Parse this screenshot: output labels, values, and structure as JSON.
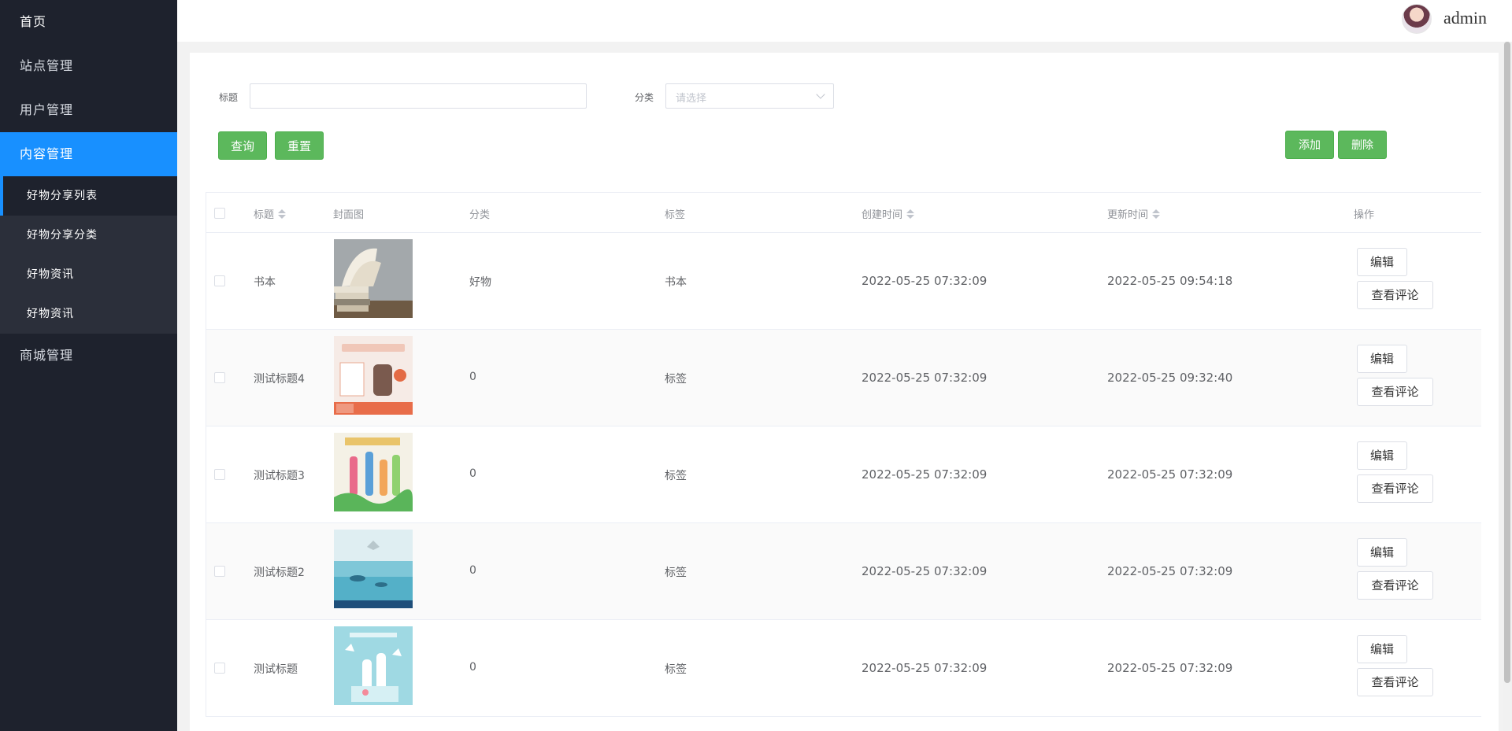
{
  "sidebar": {
    "home": "首页",
    "items": [
      {
        "label": "站点管理"
      },
      {
        "label": "用户管理"
      },
      {
        "label": "内容管理"
      }
    ],
    "submenu": [
      {
        "label": "好物分享列表"
      },
      {
        "label": "好物分享分类"
      },
      {
        "label": "好物资讯"
      },
      {
        "label": "好物资讯"
      }
    ],
    "mall": "商城管理"
  },
  "header": {
    "username": "admin",
    "avatar_icon": "user-avatar-icon"
  },
  "filters": {
    "title_label": "标题",
    "title_value": "",
    "category_label": "分类",
    "category_placeholder": "请选择"
  },
  "buttons": {
    "query": "查询",
    "reset": "重置",
    "add": "添加",
    "delete": "删除"
  },
  "table": {
    "columns": [
      "标题",
      "封面图",
      "分类",
      "标签",
      "创建时间",
      "更新时间",
      "操作"
    ],
    "rows": [
      {
        "title": "书本",
        "category": "好物",
        "tag": "书本",
        "created": "2022-05-25 07:32:09",
        "updated": "2022-05-25 09:54:18",
        "cover": "books-image"
      },
      {
        "title": "测试标题4",
        "category": "0",
        "tag": "标签",
        "created": "2022-05-25 07:32:09",
        "updated": "2022-05-25 09:32:40",
        "cover": "product-ad-image"
      },
      {
        "title": "测试标题3",
        "category": "0",
        "tag": "标签",
        "created": "2022-05-25 07:32:09",
        "updated": "2022-05-25 07:32:09",
        "cover": "bottles-grass-image"
      },
      {
        "title": "测试标题2",
        "category": "0",
        "tag": "标签",
        "created": "2022-05-25 07:32:09",
        "updated": "2022-05-25 07:32:09",
        "cover": "water-scene-image"
      },
      {
        "title": "测试标题",
        "category": "0",
        "tag": "标签",
        "created": "2022-05-25 07:32:09",
        "updated": "2022-05-25 07:32:09",
        "cover": "bottles-butterfly-image"
      }
    ],
    "edit_label": "编辑",
    "comments_label": "查看评论"
  },
  "colors": {
    "accent": "#1890ff",
    "sidebar_bg": "#1e222d",
    "button_green": "#5cb85c"
  }
}
